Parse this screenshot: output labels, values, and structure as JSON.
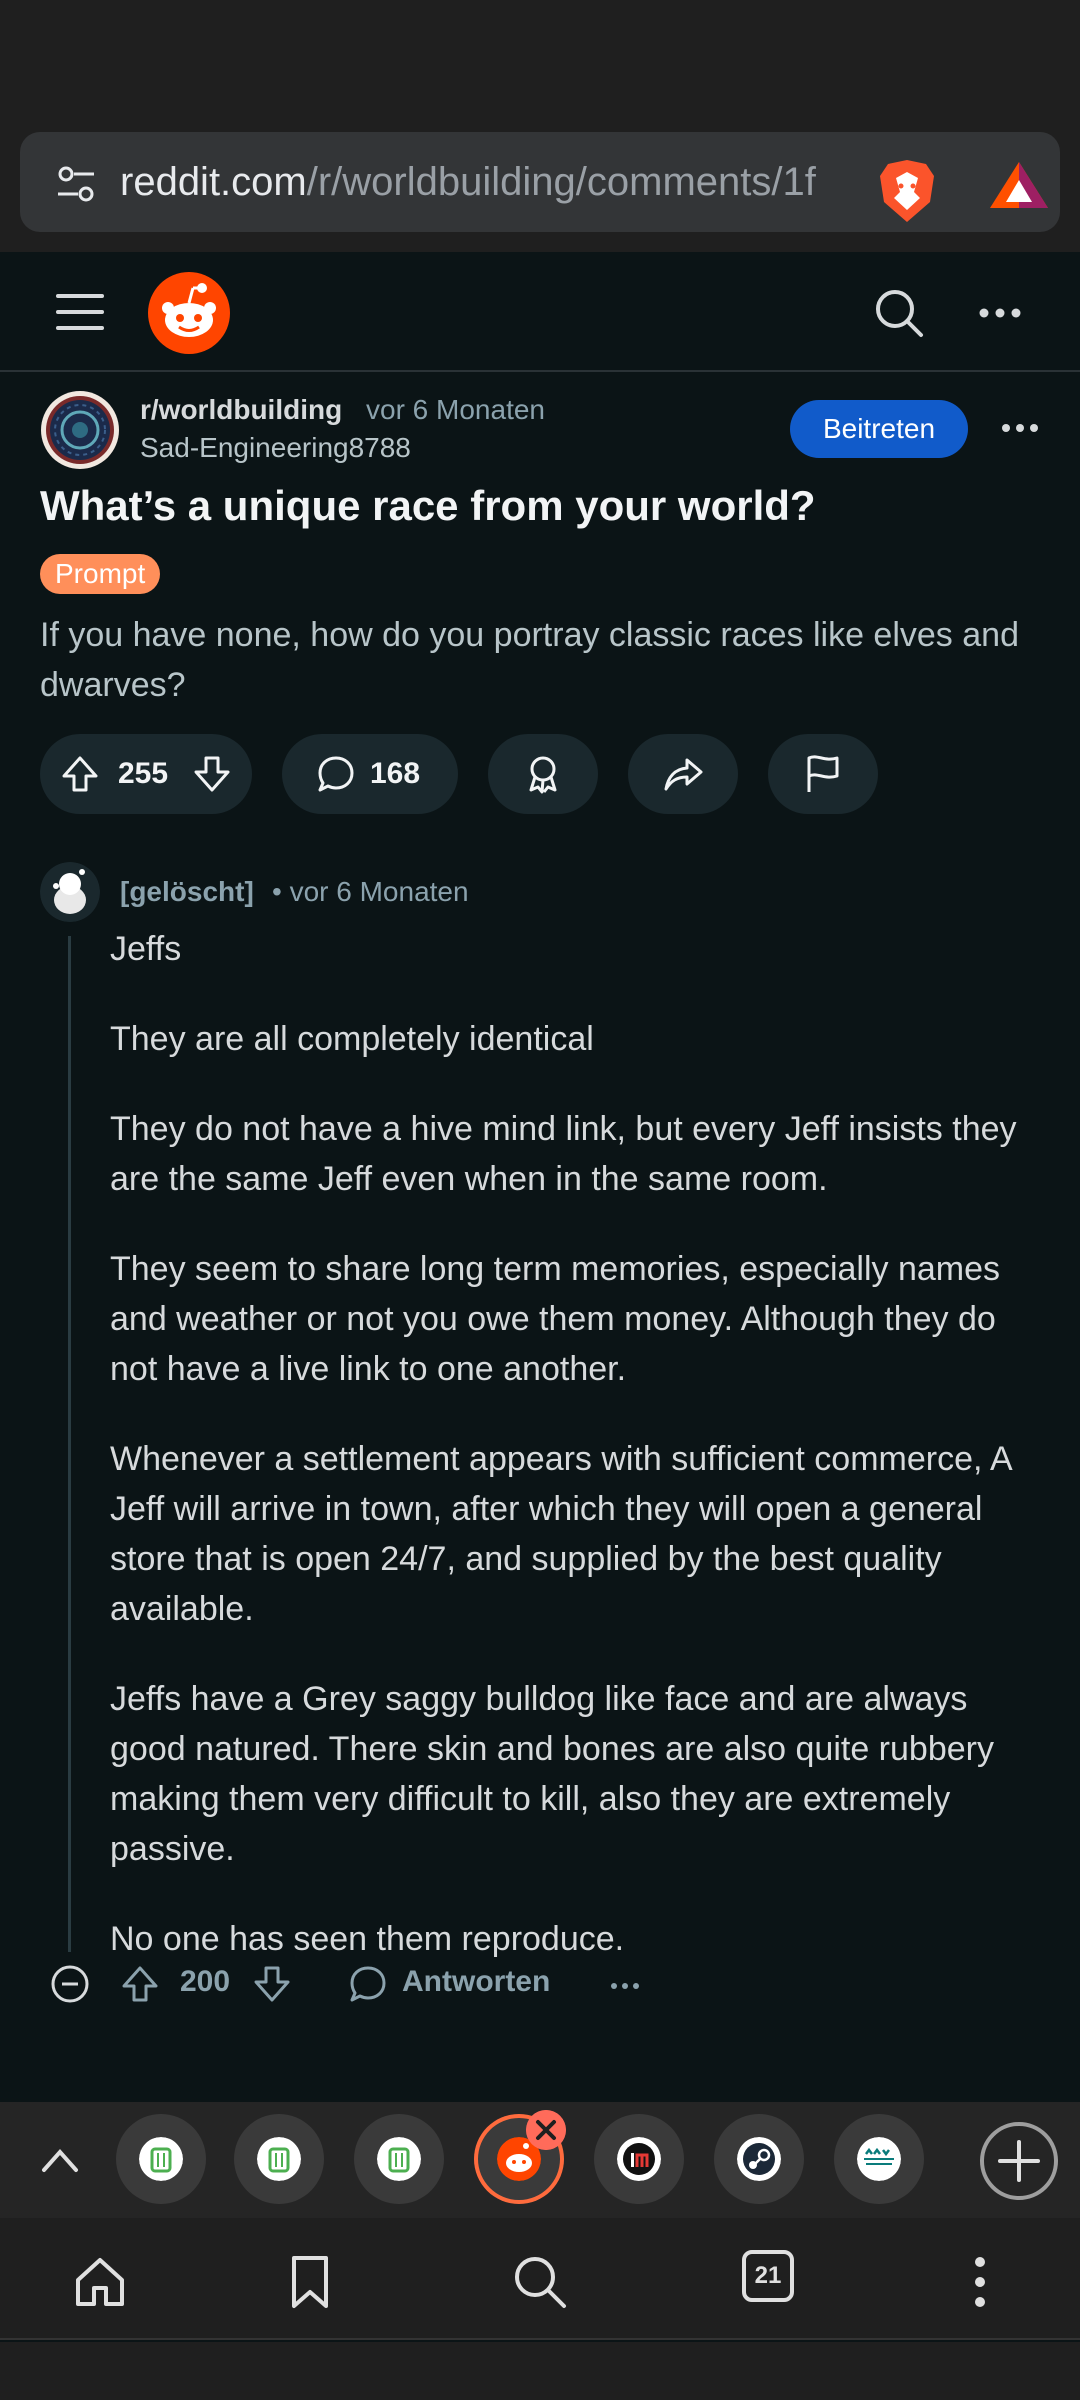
{
  "browser": {
    "url_domain": "reddit.com",
    "url_path": "/r/worldbuilding/comments/1f",
    "tab_count": "21"
  },
  "post": {
    "subreddit": "r/worldbuilding",
    "time": "vor 6 Monaten",
    "author": "Sad-Engineering8788",
    "join_label": "Beitreten",
    "title": "What’s a unique race from your world?",
    "flair": "Prompt",
    "body": "If you have none, how do you portray classic races like elves and dwarves?",
    "upvotes": "255",
    "comments": "168"
  },
  "comment": {
    "author": "[gelöscht]",
    "time": "• vor 6 Monaten",
    "paragraphs": [
      "Jeffs",
      "They are all completely identical",
      "They do not have a hive mind link, but every Jeff insists they are the same Jeff even when in the same room.",
      "They seem to share long term memories, especially names and weather or not you owe them money. Although they do not have a live link to one another.",
      "Whenever a settlement appears with sufficient commerce, A Jeff will arrive in town, after which they will open a general store that is open 24/7, and supplied by the best quality available.",
      "Jeffs have a Grey saggy bulldog like face and are always good natured. There skin and bones are also quite rubbery making them very difficult to kill, also they are extremely passive.",
      "No one has seen them reproduce."
    ],
    "score": "200",
    "reply_label": "Antworten"
  },
  "colors": {
    "background": "#0b1416",
    "join_button": "#115bca",
    "flair": "#ff8f5a",
    "reddit_orange": "#ff4500",
    "active_tab_ring": "#ff6b3d"
  }
}
